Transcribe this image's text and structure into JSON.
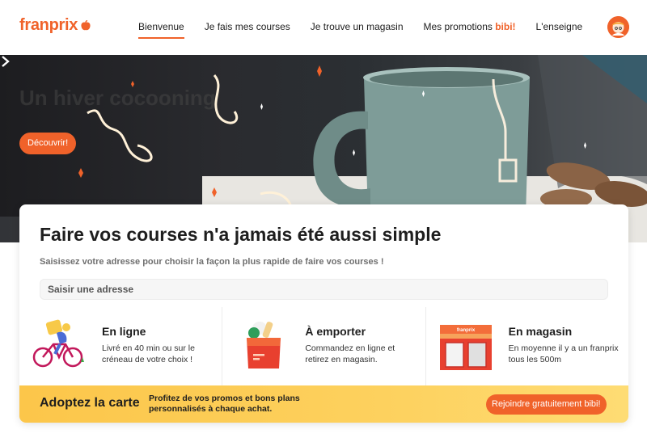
{
  "brand": {
    "name": "franprix",
    "color": "#f0622a"
  },
  "nav": {
    "items": [
      {
        "label": "Bienvenue",
        "active": true
      },
      {
        "label": "Je fais mes courses"
      },
      {
        "label": "Je trouve un magasin"
      },
      {
        "label": "Mes promotions ",
        "suffix": "bibi!"
      },
      {
        "label": "L'enseigne"
      }
    ]
  },
  "user": {
    "avatar_icon": "user-avatar-icon"
  },
  "hero": {
    "title": "Un hiver cocooning",
    "cta_label": "Découvrir!",
    "next_icon": "chevron-right-icon"
  },
  "search": {
    "title": "Faire vos courses n'a jamais été aussi simple",
    "subtitle": "Saisissez votre adresse pour choisir la façon la plus rapide de faire vos courses !",
    "placeholder": "Saisir une adresse"
  },
  "options": [
    {
      "title": "En ligne",
      "description": "Livré en 40 min ou sur le créneau de votre choix !",
      "icon": "delivery-bike-icon"
    },
    {
      "title": "À emporter",
      "description": "Commandez en ligne et retirez en magasin.",
      "icon": "shopping-bag-icon"
    },
    {
      "title": "En magasin",
      "description": "En moyenne il y a un franprix tous les 500m",
      "icon": "store-front-icon"
    }
  ],
  "loyalty": {
    "title": "Adoptez la carte",
    "description": "Profitez de vos promos et bons plans personnalisés à chaque achat.",
    "button_label": "Rejoindre gratuitement bibi!"
  },
  "colors": {
    "accent": "#f0622a",
    "yellow": "#fdd15e",
    "mug": "#7e9c98"
  }
}
